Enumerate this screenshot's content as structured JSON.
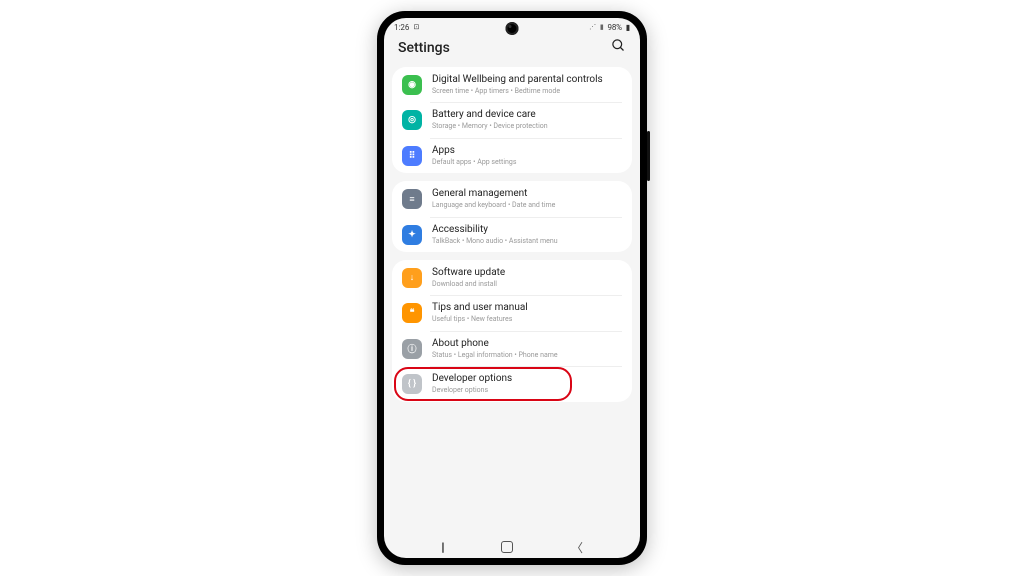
{
  "status": {
    "time": "1:26",
    "battery_text": "98%"
  },
  "header": {
    "title": "Settings"
  },
  "groups": [
    {
      "items": [
        {
          "title": "Digital Wellbeing and parental controls",
          "sub": "Screen time  •  App timers  •  Bedtime mode",
          "icon_name": "wellbeing-icon",
          "color": "bg-green1"
        },
        {
          "title": "Battery and device care",
          "sub": "Storage  •  Memory  •  Device protection",
          "icon_name": "device-care-icon",
          "color": "bg-teal"
        },
        {
          "title": "Apps",
          "sub": "Default apps  •  App settings",
          "icon_name": "apps-icon",
          "color": "bg-blue1"
        }
      ]
    },
    {
      "items": [
        {
          "title": "General management",
          "sub": "Language and keyboard  •  Date and time",
          "icon_name": "general-management-icon",
          "color": "bg-gray1"
        },
        {
          "title": "Accessibility",
          "sub": "TalkBack  •  Mono audio  •  Assistant menu",
          "icon_name": "accessibility-icon",
          "color": "bg-blue2"
        }
      ]
    },
    {
      "items": [
        {
          "title": "Software update",
          "sub": "Download and install",
          "icon_name": "software-update-icon",
          "color": "bg-orange"
        },
        {
          "title": "Tips and user manual",
          "sub": "Useful tips  •  New features",
          "icon_name": "tips-icon",
          "color": "bg-orange2"
        },
        {
          "title": "About phone",
          "sub": "Status  •  Legal information  •  Phone name",
          "icon_name": "about-phone-icon",
          "color": "bg-gray2"
        },
        {
          "title": "Developer options",
          "sub": "Developer options",
          "icon_name": "developer-options-icon",
          "color": "bg-gray3",
          "highlighted": true
        }
      ]
    }
  ],
  "icon_glyphs": {
    "wellbeing-icon": "◉",
    "device-care-icon": "◎",
    "apps-icon": "⠿",
    "general-management-icon": "≡",
    "accessibility-icon": "✦",
    "software-update-icon": "↓",
    "tips-icon": "❝",
    "about-phone-icon": "ⓘ",
    "developer-options-icon": "{ }"
  }
}
